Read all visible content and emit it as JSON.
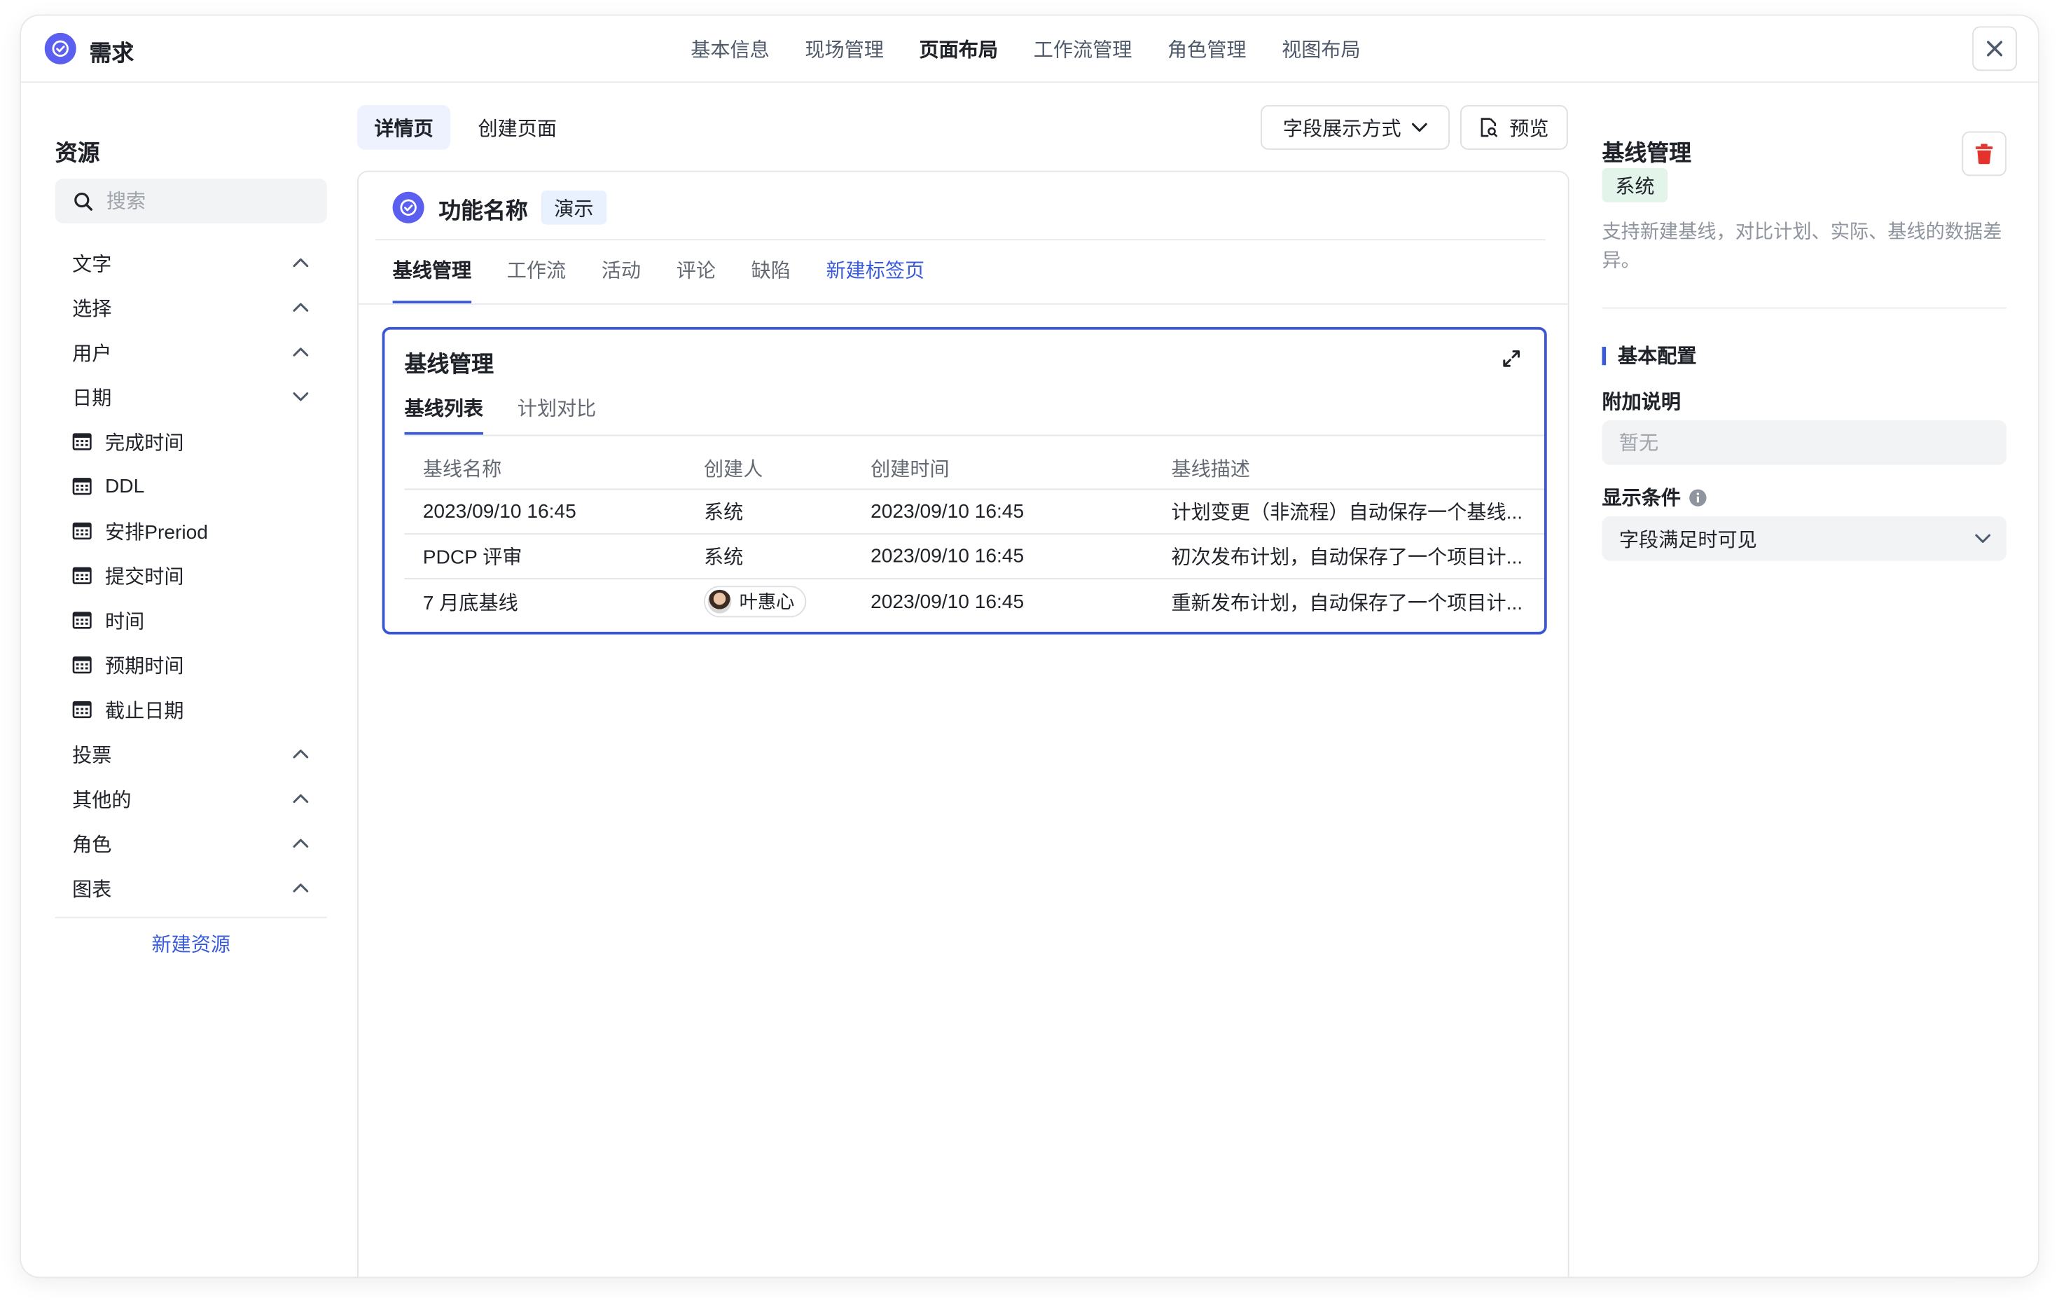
{
  "app": {
    "title": "需求"
  },
  "top_nav": [
    {
      "label": "基本信息"
    },
    {
      "label": "现场管理"
    },
    {
      "label": "页面布局",
      "active": true
    },
    {
      "label": "工作流管理"
    },
    {
      "label": "角色管理"
    },
    {
      "label": "视图布局"
    }
  ],
  "sidebar": {
    "title": "资源",
    "search_placeholder": "搜索",
    "groups": [
      {
        "label": "文字",
        "expanded": false
      },
      {
        "label": "选择",
        "expanded": false
      },
      {
        "label": "用户",
        "expanded": false
      },
      {
        "label": "日期",
        "expanded": true
      },
      {
        "label": "投票",
        "expanded": false
      },
      {
        "label": "其他的",
        "expanded": false
      },
      {
        "label": "角色",
        "expanded": false
      },
      {
        "label": "图表",
        "expanded": false
      }
    ],
    "date_items": [
      "完成时间",
      "DDL",
      "安排Preriod",
      "提交时间",
      "时间",
      "预期时间",
      "截止日期"
    ],
    "new_resource": "新建资源"
  },
  "center": {
    "page_tabs": [
      {
        "label": "详情页",
        "active": true
      },
      {
        "label": "创建页面"
      }
    ],
    "field_mode_label": "字段展示方式",
    "preview_label": "预览",
    "feature": {
      "name": "功能名称",
      "tag": "演示"
    },
    "detail_tabs": [
      {
        "label": "基线管理",
        "active": true
      },
      {
        "label": "工作流"
      },
      {
        "label": "活动"
      },
      {
        "label": "评论"
      },
      {
        "label": "缺陷"
      },
      {
        "label": "新建标签页",
        "new": true
      }
    ],
    "baseline": {
      "title": "基线管理",
      "tabs": [
        {
          "label": "基线列表",
          "active": true
        },
        {
          "label": "计划对比"
        }
      ],
      "columns": [
        "基线名称",
        "创建人",
        "创建时间",
        "基线描述"
      ],
      "rows": [
        {
          "name": "2023/09/10 16:45",
          "creator": "系统",
          "created": "2023/09/10 16:45",
          "desc": "计划变更（非流程）自动保存一个基线..."
        },
        {
          "name": "PDCP 评审",
          "creator": "系统",
          "created": "2023/09/10 16:45",
          "desc": "初次发布计划，自动保存了一个项目计..."
        },
        {
          "name": "7 月底基线",
          "creator": "叶惠心",
          "creator_is_user": true,
          "created": "2023/09/10 16:45",
          "desc": "重新发布计划，自动保存了一个项目计..."
        }
      ]
    }
  },
  "right_panel": {
    "title": "基线管理",
    "tag": "系统",
    "description": "支持新建基线，对比计划、实际、基线的数据差异。",
    "section_title": "基本配置",
    "note_label": "附加说明",
    "note_placeholder": "暂无",
    "condition_label": "显示条件",
    "condition_value": "字段满足时可见"
  },
  "colors": {
    "accent": "#3a5bd9",
    "logo": "#5b5ff0",
    "delete": "#e5322d",
    "system_tag_bg": "#e3f4ea"
  }
}
